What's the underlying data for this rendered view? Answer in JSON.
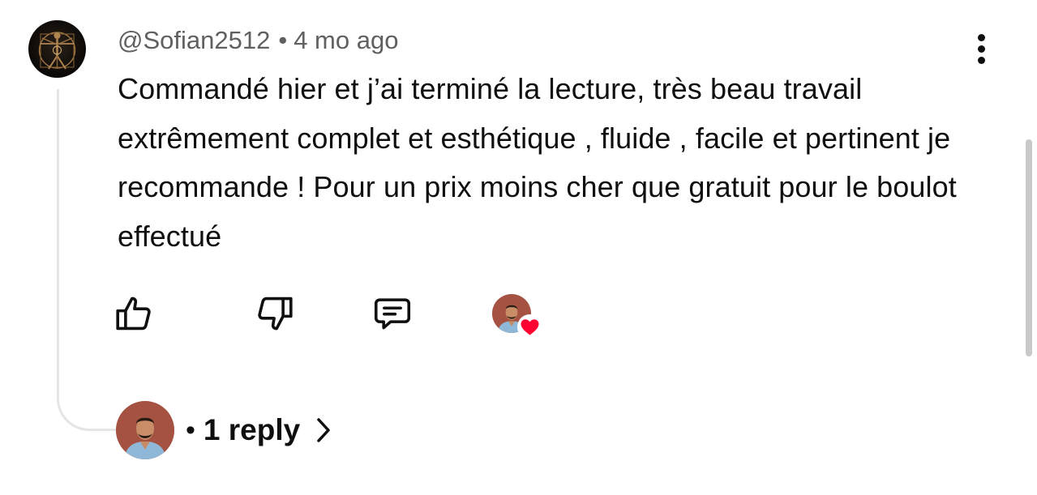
{
  "comment": {
    "author": "@Sofian2512",
    "separator": "•",
    "time": "4 mo ago",
    "text": "Commandé hier et j’ai terminé la lecture, très beau travail extrêmement complet et esthétique , fluide , facile et pertinent je recommande ! Pour un prix moins cher que gratuit pour le boulot effectué"
  },
  "actions": {
    "like_icon": "thumbs-up-icon",
    "dislike_icon": "thumbs-down-icon",
    "reply_icon": "comment-icon",
    "creator_heart_icon": "heart-icon"
  },
  "replies": {
    "dot": "•",
    "count_label": "1 reply",
    "chevron_icon": "chevron-right-icon"
  },
  "colors": {
    "text": "#0f0f0f",
    "meta": "#606060",
    "heart": "#ff0033",
    "thread_line": "#e5e5e5"
  }
}
